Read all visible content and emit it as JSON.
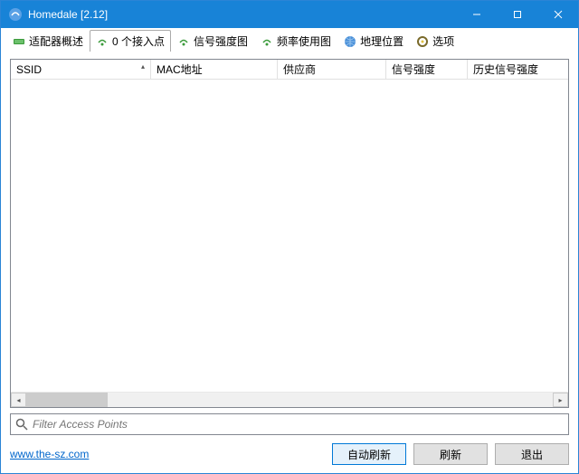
{
  "window": {
    "title": "Homedale [2.12]"
  },
  "tabs": [
    {
      "label": "适配器概述",
      "icon": "card-icon"
    },
    {
      "label": "0 个接入点",
      "icon": "signal-icon",
      "active": true
    },
    {
      "label": "信号强度图",
      "icon": "signal-icon"
    },
    {
      "label": "频率使用图",
      "icon": "signal-icon"
    },
    {
      "label": "地理位置",
      "icon": "globe-icon"
    },
    {
      "label": "选项",
      "icon": "gear-icon"
    }
  ],
  "columns": {
    "ssid": "SSID",
    "mac": "MAC地址",
    "vendor": "供应商",
    "signal": "信号强度",
    "history": "历史信号强度"
  },
  "filter": {
    "placeholder": "Filter Access Points"
  },
  "footer": {
    "url": "www.the-sz.com",
    "auto_refresh": "自动刷新",
    "refresh": "刷新",
    "exit": "退出"
  }
}
